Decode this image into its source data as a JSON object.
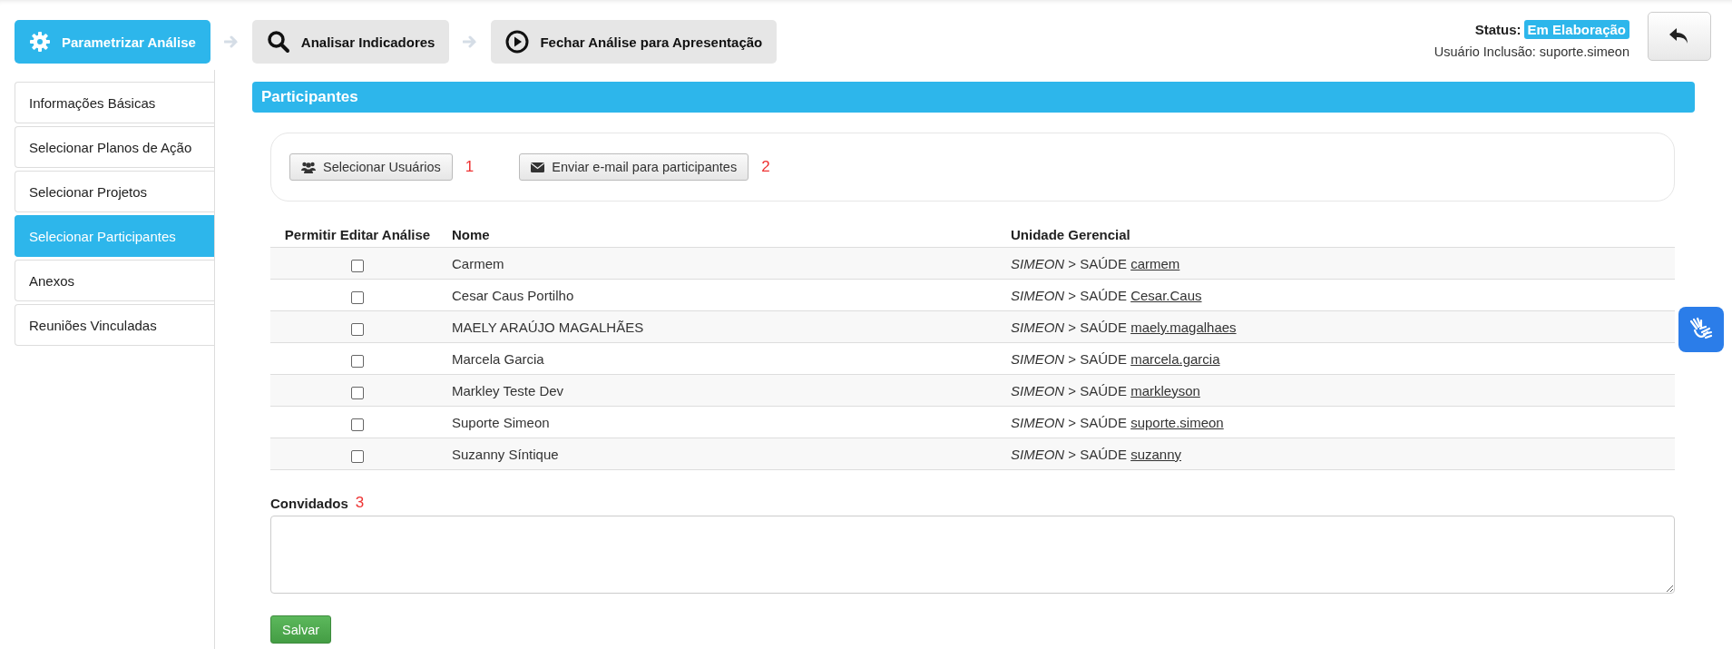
{
  "steps": [
    {
      "label": "Parametrizar Análise",
      "selected": true,
      "kind": "gear"
    },
    {
      "label": "Analisar Indicadores",
      "selected": false,
      "kind": "search"
    },
    {
      "label": "Fechar Análise para Apresentação",
      "selected": false,
      "kind": "play"
    }
  ],
  "status": {
    "label": "Status:",
    "value": "Em Elaboração",
    "user": "Usuário Inclusão: suporte.simeon"
  },
  "sidebar": {
    "items": [
      {
        "label": "Informações Básicas",
        "selected": false
      },
      {
        "label": "Selecionar Planos de Ação",
        "selected": false
      },
      {
        "label": "Selecionar Projetos",
        "selected": false
      },
      {
        "label": "Selecionar Participantes",
        "selected": true
      },
      {
        "label": "Anexos",
        "selected": false
      },
      {
        "label": "Reuniões Vinculadas",
        "selected": false
      }
    ]
  },
  "panel": {
    "title": "Participantes",
    "toolbar": [
      {
        "label": "Selecionar Usuários",
        "kind": "users",
        "note": "1"
      },
      {
        "label": "Enviar e-mail para participantes",
        "kind": "mail",
        "note": "2"
      }
    ],
    "table": {
      "columns": [
        "Permitir Editar Análise",
        "Nome",
        "Unidade Gerencial"
      ],
      "rows": [
        {
          "checked": false,
          "name": "Carmem",
          "unit": "*SIMEON* > SAÚDE",
          "login": "carmem"
        },
        {
          "checked": false,
          "name": "Cesar Caus Portilho",
          "unit": "*SIMEON* > SAÚDE",
          "login": "Cesar.Caus"
        },
        {
          "checked": false,
          "name": "MAELY ARAÚJO MAGALHÃES",
          "unit": "*SIMEON* > SAÚDE",
          "login": "maely.magalhaes"
        },
        {
          "checked": false,
          "name": "Marcela Garcia",
          "unit": "*SIMEON* > SAÚDE",
          "login": "marcela.garcia"
        },
        {
          "checked": false,
          "name": "Markley Teste Dev",
          "unit": "*SIMEON* > SAÚDE",
          "login": "markleyson"
        },
        {
          "checked": false,
          "name": "Suporte Simeon",
          "unit": "*SIMEON* > SAÚDE",
          "login": "suporte.simeon"
        },
        {
          "checked": false,
          "name": "Suzanny Síntique",
          "unit": "*SIMEON* > SAÚDE",
          "login": "suzanny"
        }
      ]
    },
    "invitees": {
      "label": "Convidados",
      "note": "3"
    },
    "save_button": "Salvar"
  }
}
